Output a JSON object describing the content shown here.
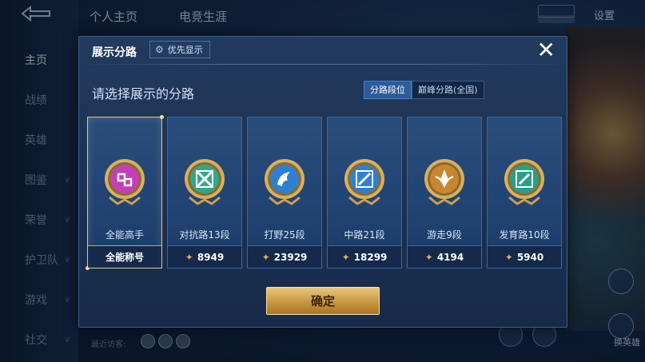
{
  "nav": {
    "items": [
      {
        "label": "主页",
        "active": true
      },
      {
        "label": "战绩"
      },
      {
        "label": "英雄"
      },
      {
        "label": "图鉴",
        "chevron": true
      },
      {
        "label": "荣誉",
        "chevron": true
      },
      {
        "label": "护卫队",
        "chevron": true
      },
      {
        "label": "游戏",
        "chevron": true
      },
      {
        "label": "社交",
        "chevron": true
      }
    ]
  },
  "top_tabs": [
    "个人主页",
    "电竞生涯"
  ],
  "settings_label": "设置",
  "recent_label": "最近访客:",
  "side_label": "换英雄",
  "dialog": {
    "title": "展示分路",
    "priority_btn": "优先显示",
    "prompt": "请选择展示的分路",
    "toggle": [
      {
        "label": "分路段位",
        "active": true
      },
      {
        "label": "巅峰分路(全国)"
      }
    ],
    "cards": [
      {
        "label": "全能高手",
        "value": "全能称号",
        "selected": true,
        "color": "#c23fb8",
        "glyph": "omni"
      },
      {
        "label": "对抗路13段",
        "value": "8949",
        "color": "#2fa98a",
        "glyph": "clash"
      },
      {
        "label": "打野25段",
        "value": "23929",
        "color": "#2f7fd0",
        "glyph": "jungle"
      },
      {
        "label": "中路21段",
        "value": "18299",
        "color": "#2e7fd6",
        "glyph": "mid"
      },
      {
        "label": "游走9段",
        "value": "4194",
        "color": "#c8872e",
        "glyph": "roam"
      },
      {
        "label": "发育路10段",
        "value": "5940",
        "color": "#28a088",
        "glyph": "farm"
      }
    ],
    "confirm_label": "确定"
  }
}
